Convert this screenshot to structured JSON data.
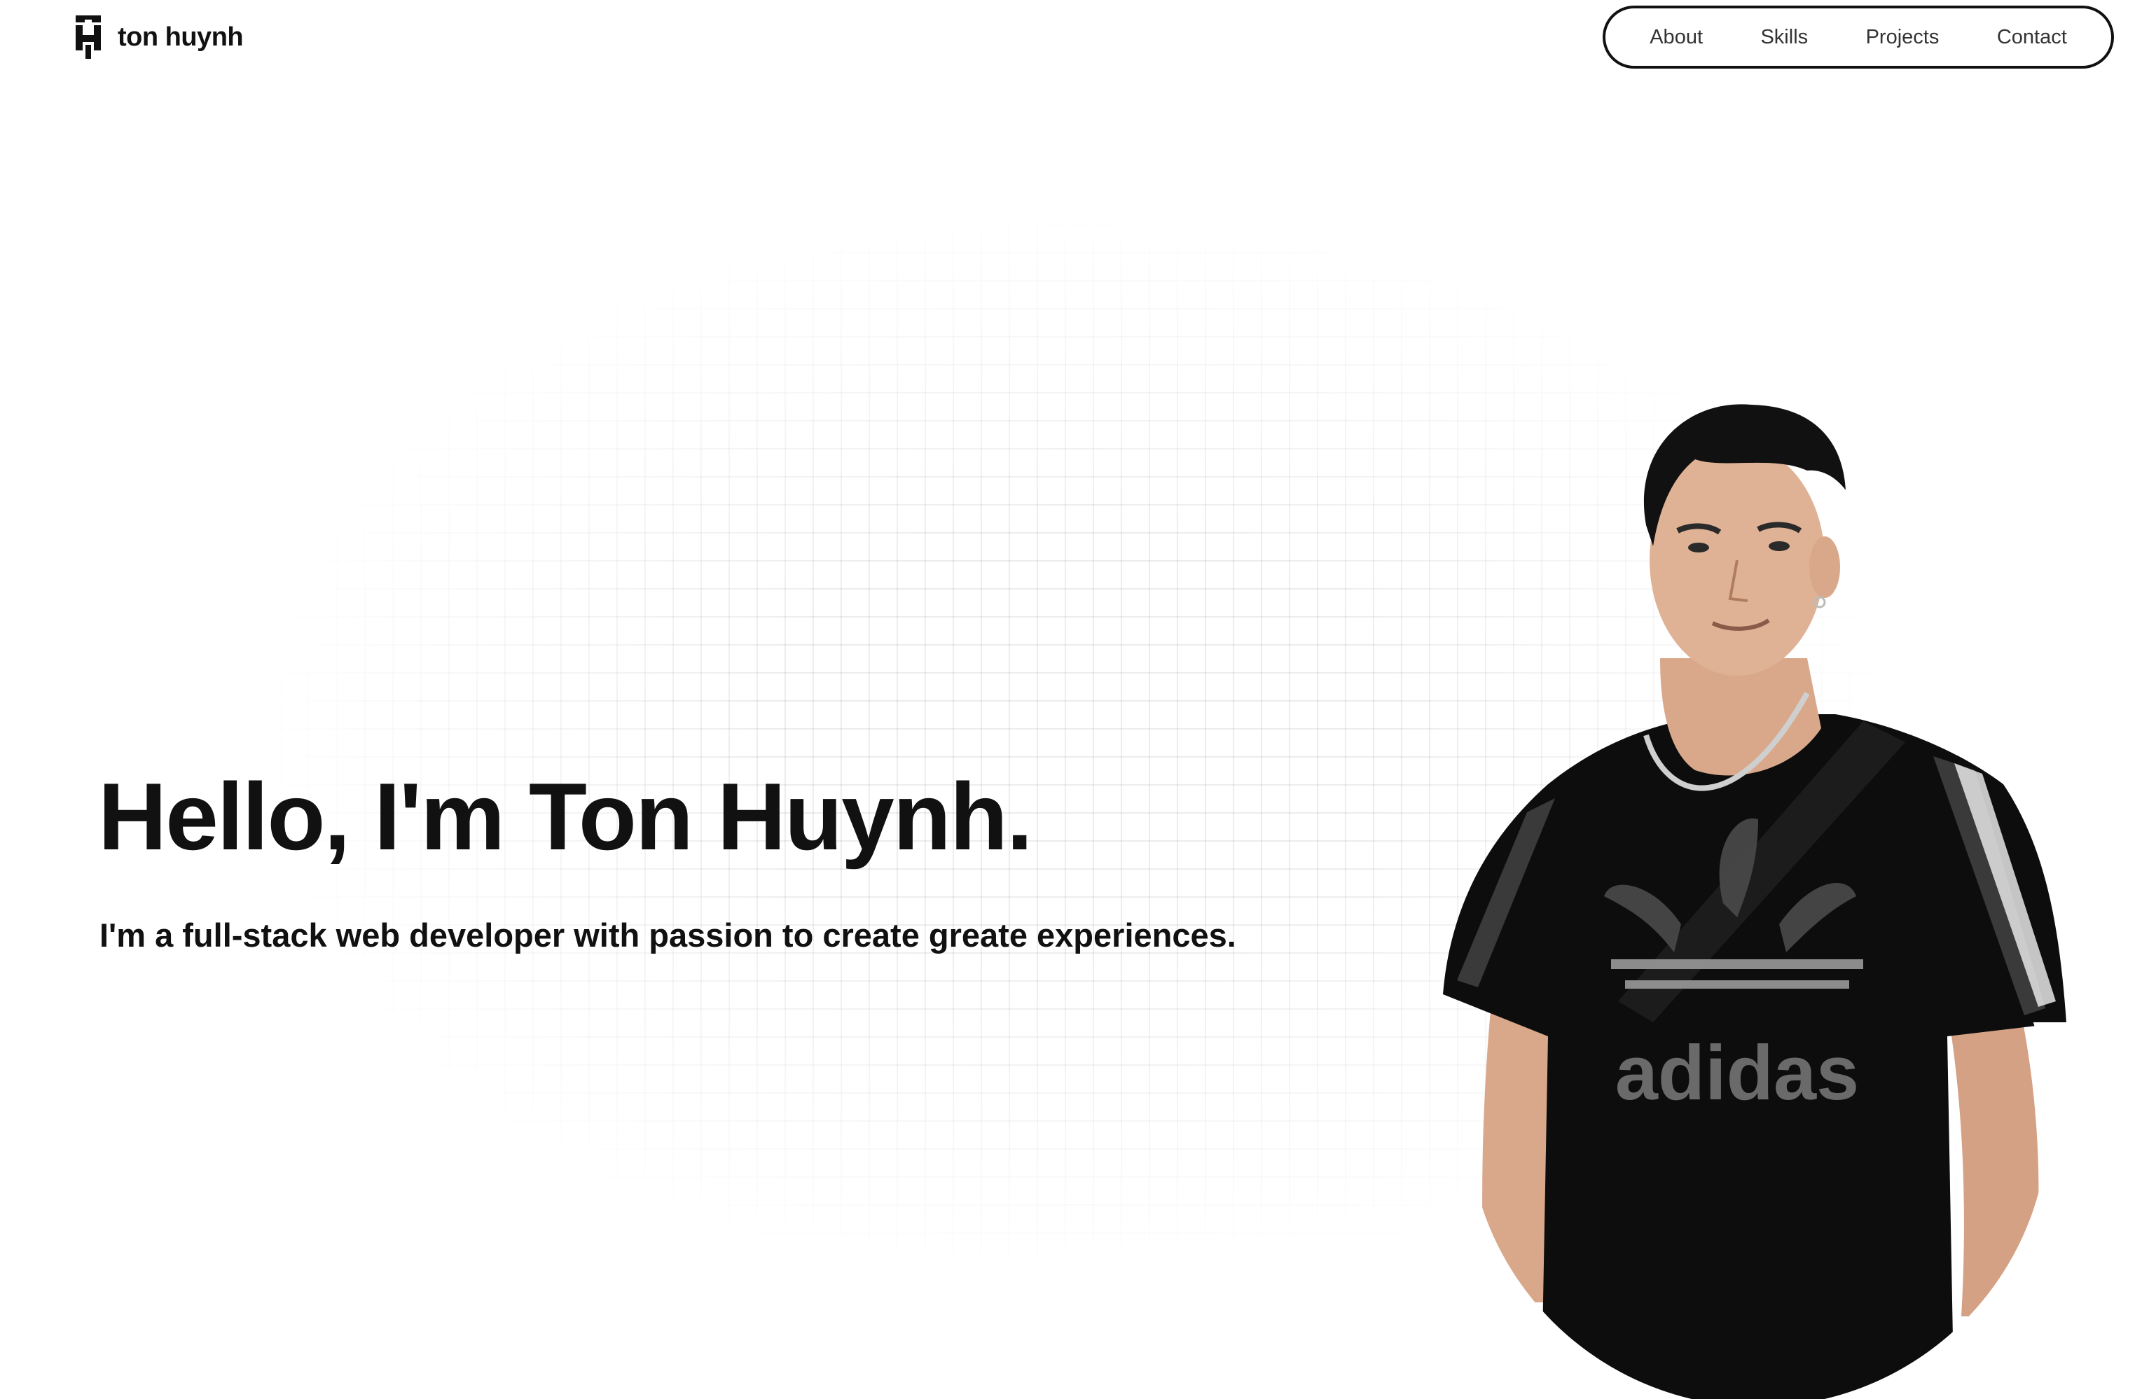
{
  "brand": {
    "name": "ton huynh",
    "logo_icon": "th-monogram-icon"
  },
  "nav": {
    "items": [
      {
        "label": "About"
      },
      {
        "label": "Skills"
      },
      {
        "label": "Projects"
      },
      {
        "label": "Contact"
      }
    ]
  },
  "hero": {
    "title": "Hello, I'm Ton Huynh.",
    "subtitle": "I'm a full-stack web developer with passion to create greate experiences.",
    "portrait_shirt_text": "adidas"
  },
  "colors": {
    "text": "#111111",
    "background": "#ffffff",
    "grid_line": "#ededed",
    "nav_border": "#111111"
  }
}
